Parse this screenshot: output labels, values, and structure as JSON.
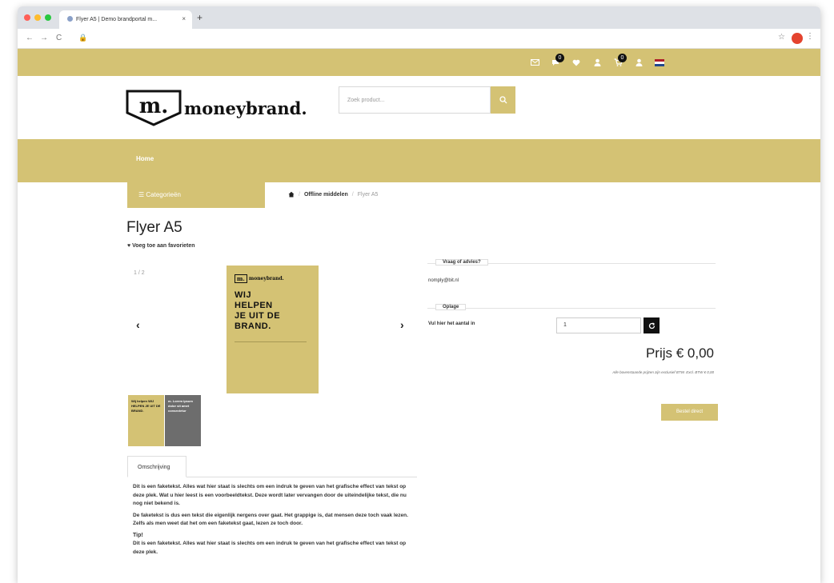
{
  "browser": {
    "tab_title": "Flyer A5 | Demo brandportal m...",
    "tab_close": "×",
    "new_tab": "+",
    "back": "←",
    "forward": "→",
    "reload": "C",
    "lock": "🔒",
    "bookmark": "☆",
    "menu": "⋮"
  },
  "topbar": {
    "badges": [
      "0",
      "0"
    ],
    "flag_colors": [
      "#ae1c28",
      "#ffffff",
      "#21468b"
    ]
  },
  "header": {
    "logo_mark": "m.",
    "logo_text": "moneybrand.",
    "search_placeholder": "Zoek product..."
  },
  "navbar": {
    "home": "Home"
  },
  "categories_label": "☰  Categorieën",
  "breadcrumb": {
    "item1": "Offline middelen",
    "separator": "/",
    "current": "Flyer A5"
  },
  "product": {
    "title": "Flyer A5",
    "favorite": "♥ Voeg toe aan favorieten",
    "counter": "1 / 2",
    "prev": "‹",
    "next": "›"
  },
  "poster": {
    "logo_mark": "m.",
    "logo_text": "moneybrand.",
    "lines": [
      "WIJ",
      "HELPEN",
      "JE UIT DE",
      "BRAND."
    ]
  },
  "thumbs": [
    {
      "text": "Wij helpen WIJ HELPEN JE UIT DE BRAND.",
      "bg": "#d4c274",
      "color": "#111111"
    },
    {
      "text": "m. Lorem ipsum dolor sit amet consectetur",
      "bg": "#6d6d6d",
      "color": "#ffffff"
    }
  ],
  "tabs": {
    "description": "Omschrijving"
  },
  "description": {
    "p1": "Dit is een faketekst. Alles wat hier staat is slechts om een indruk te geven van het grafische effect van tekst op deze plek. Wat u hier leest is een voorbeeldtekst. Deze wordt later vervangen door de uiteindelijke tekst, die nu nog niet bekend is.",
    "p2": "De faketekst is dus een tekst die eigenlijk nergens over gaat. Het grappige is, dat mensen deze toch vaak lezen. Zelfs als men weet dat het om een faketekst gaat, lezen ze toch door.",
    "tip_title": "Tip!",
    "tip_text": "Dit is een faketekst. Alles wat hier staat is slechts om een indruk te geven van het grafische effect van tekst op deze plek."
  },
  "advice": {
    "legend": "Vraag of advies?",
    "email": "nomply@bit.nl"
  },
  "quantity": {
    "legend": "Oplage",
    "label": "Vul hier het aantal in",
    "value": "1"
  },
  "price": {
    "text": "Prijs € 0,00",
    "vat_note": "Alle bovenstaande prijzen zijn exclusief BTW. Excl. BTW € 0,00"
  },
  "order_button": "Bestel direct",
  "colors": {
    "brand": "#d4c274",
    "dark": "#111111"
  }
}
